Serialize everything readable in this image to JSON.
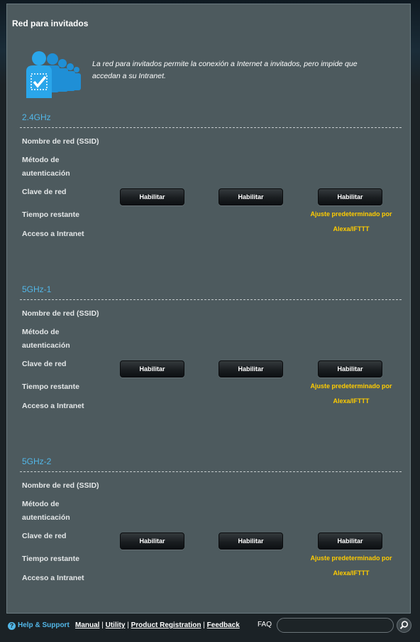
{
  "page": {
    "title": "Red para invitados",
    "intro": "La red para invitados permite la conexión a Internet a invitados, pero impide que accedan a su Intranet."
  },
  "labels": {
    "ssid": "Nombre de red (SSID)",
    "auth_line1": "Método de",
    "auth_line2": "autenticación",
    "key": "Clave de red",
    "time": "Tiempo restante",
    "intranet": "Acceso a Intranet"
  },
  "sections": [
    {
      "title": "2.4GHz",
      "buttons": [
        "Habilitar",
        "Habilitar",
        "Habilitar"
      ],
      "note_line1": "Ajuste predeterminado por",
      "note_line2": "Alexa/IFTTT"
    },
    {
      "title": "5GHz-1",
      "buttons": [
        "Habilitar",
        "Habilitar",
        "Habilitar"
      ],
      "note_line1": "Ajuste predeterminado por",
      "note_line2": "Alexa/IFTTT"
    },
    {
      "title": "5GHz-2",
      "buttons": [
        "Habilitar",
        "Habilitar",
        "Habilitar"
      ],
      "note_line1": "Ajuste predeterminado por",
      "note_line2": "Alexa/IFTTT"
    }
  ],
  "footer": {
    "help": "Help & Support",
    "manual": "Manual",
    "utility": "Utility",
    "registration": "Product Registration",
    "feedback": "Feedback",
    "faq": "FAQ",
    "search_value": ""
  },
  "colors": {
    "accent": "#52b7e8",
    "note": "#ffcc00",
    "panel": "#4d5a5e"
  }
}
